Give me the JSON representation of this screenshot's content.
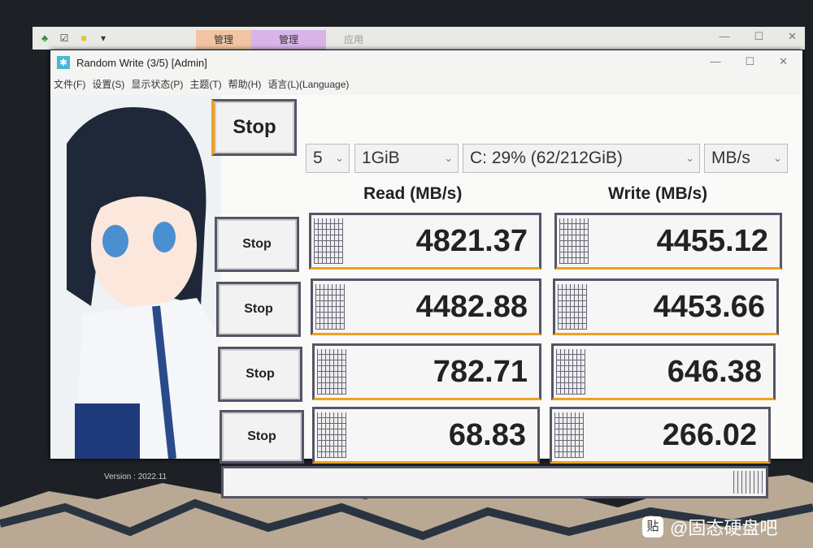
{
  "explorer": {
    "tabs": [
      "管理",
      "管理",
      "应用"
    ],
    "tab_colors": [
      "#f2c4a4",
      "#d8b4e8",
      "#e9e9e6"
    ]
  },
  "window": {
    "title": "Random Write (3/5) [Admin]",
    "menu": [
      "文件(F)",
      "设置(S)",
      "显示状态(P)",
      "主题(T)",
      "帮助(H)",
      "语言(L)(Language)"
    ]
  },
  "controls": {
    "all_button": "Stop",
    "count": "5",
    "size": "1GiB",
    "drive": "C: 29% (62/212GiB)",
    "unit": "MB/s"
  },
  "headers": {
    "read": "Read (MB/s)",
    "write": "Write (MB/s)"
  },
  "rows": [
    {
      "button": "Stop",
      "read": "4821.37",
      "write": "4455.12"
    },
    {
      "button": "Stop",
      "read": "4482.88",
      "write": "4453.66"
    },
    {
      "button": "Stop",
      "read": "782.71",
      "write": "646.38"
    },
    {
      "button": "Stop",
      "read": "68.83",
      "write": "266.02"
    }
  ],
  "version": "Version : 2022.11",
  "watermark": {
    "logo": "贴",
    "text": "@固态硬盘吧"
  },
  "colors": {
    "accent": "#f0a020",
    "border": "#555566"
  }
}
